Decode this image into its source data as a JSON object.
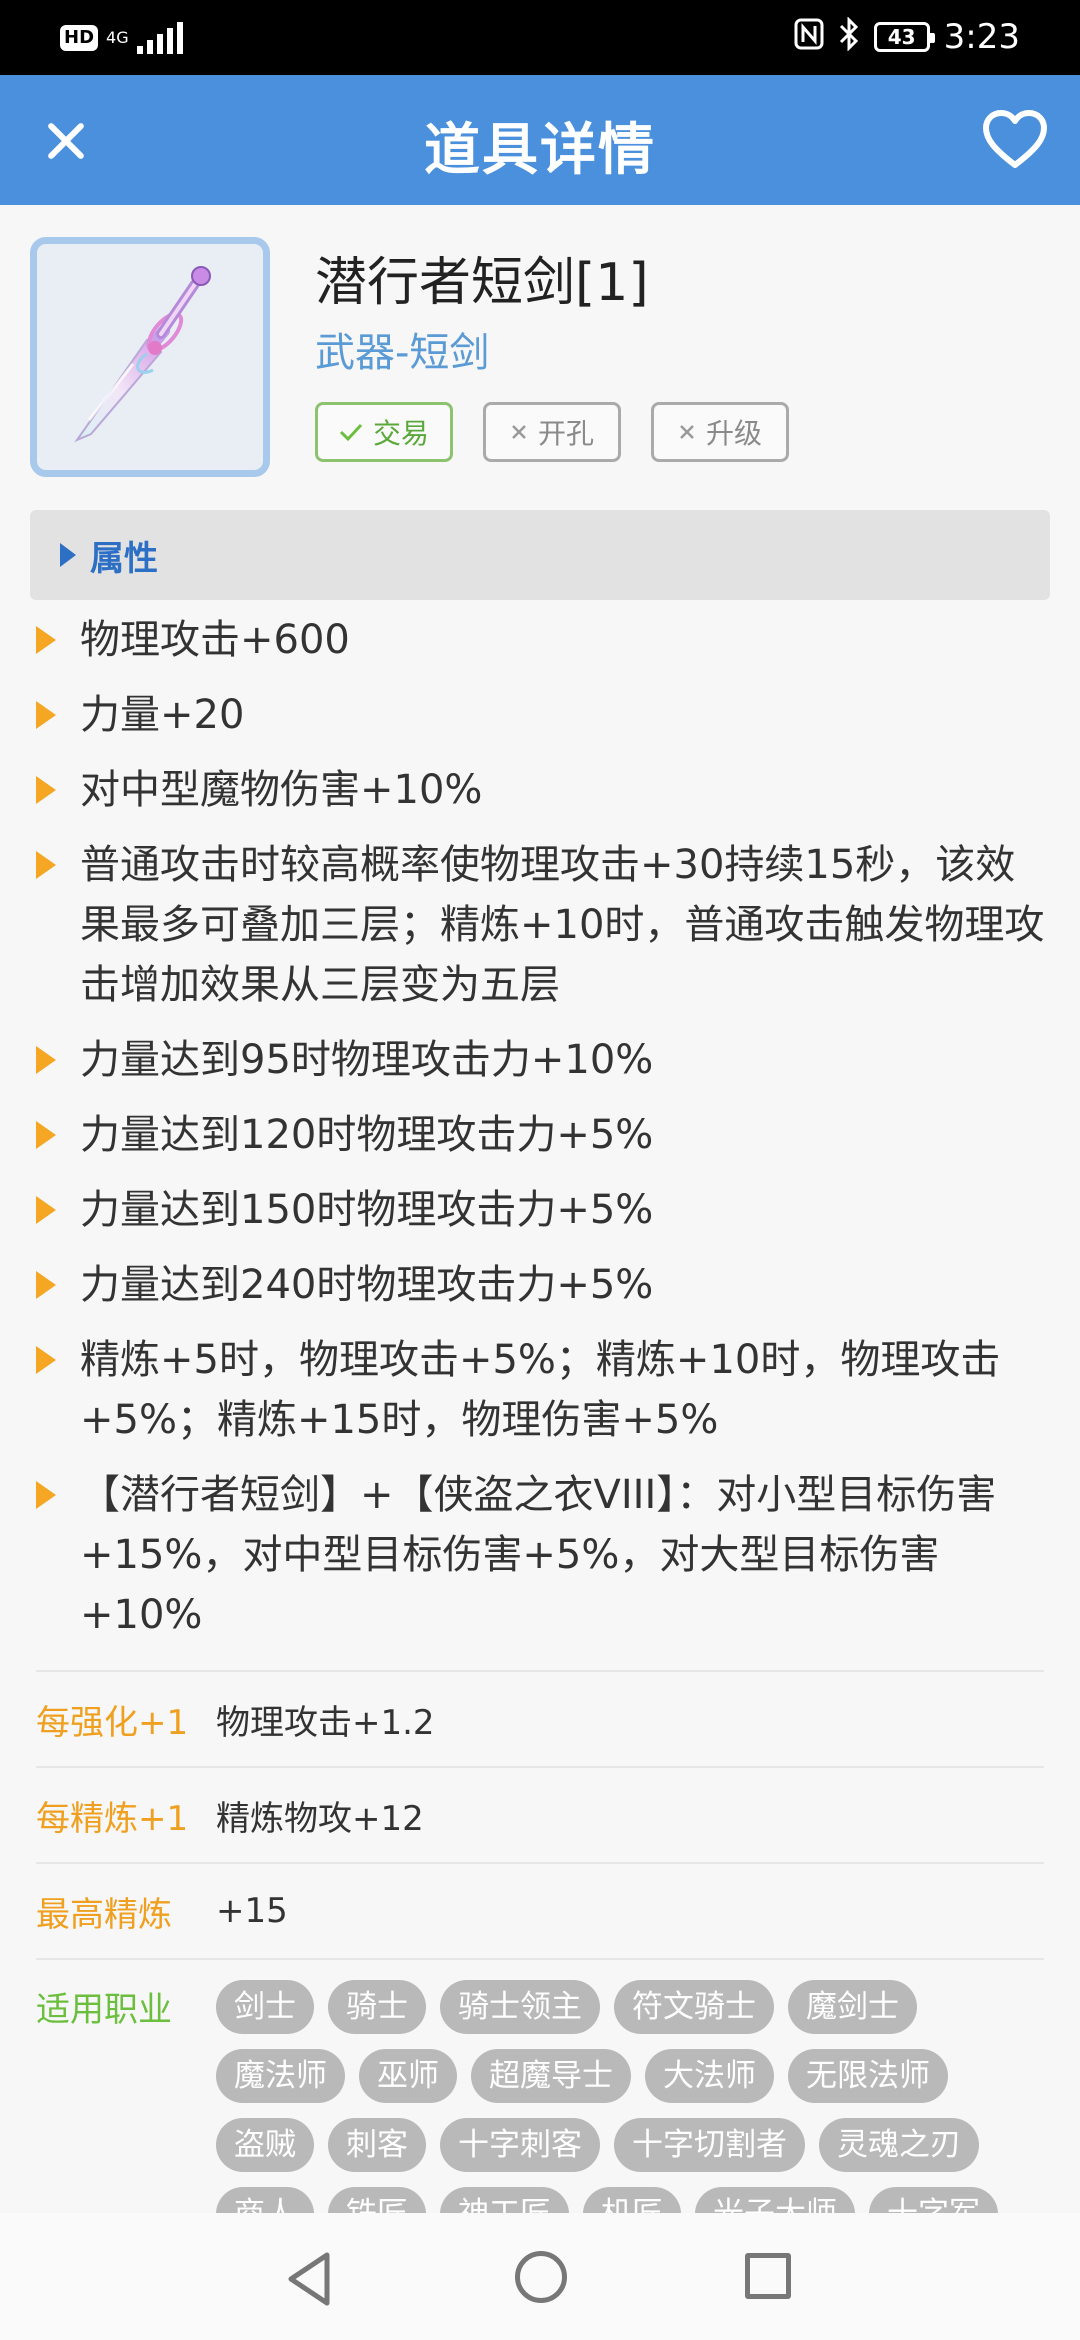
{
  "status_bar": {
    "hd": "HD",
    "network": "4G",
    "battery": "43",
    "time": "3:23"
  },
  "header": {
    "title": "道具详情"
  },
  "item": {
    "name": "潜行者短剑[1]",
    "type": "武器-短剑",
    "tags": [
      {
        "label": "交易",
        "state": "check"
      },
      {
        "label": "开孔",
        "state": "cross"
      },
      {
        "label": "升级",
        "state": "cross"
      }
    ]
  },
  "section": {
    "label": "属性"
  },
  "attributes": [
    "物理攻击+600",
    "力量+20",
    "对中型魔物伤害+10%",
    "普通攻击时较高概率使物理攻击+30持续15秒，该效果最多可叠加三层；精炼+10时，普通攻击触发物理攻击增加效果从三层变为五层",
    "力量达到95时物理攻击力+10%",
    "力量达到120时物理攻击力+5%",
    "力量达到150时物理攻击力+5%",
    "力量达到240时物理攻击力+5%",
    "精炼+5时，物理攻击+5%；精炼+10时，物理攻击+5%；精炼+15时，物理伤害+5%",
    "【潜行者短剑】+【侠盗之衣VIII】：对小型目标伤害+15%，对中型目标伤害+5%，对大型目标伤害+10%"
  ],
  "info": {
    "enhance_label": "每强化+1",
    "enhance_value": "物理攻击+1.2",
    "refine_label": "每精炼+1",
    "refine_value": "精炼物攻+12",
    "max_refine_label": "最高精炼",
    "max_refine_value": "+15",
    "jobs_label": "适用职业",
    "jobs": [
      "剑士",
      "骑士",
      "骑士领主",
      "符文骑士",
      "魔剑士",
      "魔法师",
      "巫师",
      "超魔导士",
      "大法师",
      "无限法师",
      "盗贼",
      "刺客",
      "十字刺客",
      "十字切割者",
      "灵魂之刃",
      "商人",
      "铁匠",
      "神工匠",
      "机匠",
      "光子大师",
      "十字军"
    ]
  },
  "colors": {
    "header": "#4a90dd",
    "accent_orange": "#f0a020",
    "accent_green": "#6cbf3e",
    "link_blue": "#5b9bd5"
  }
}
